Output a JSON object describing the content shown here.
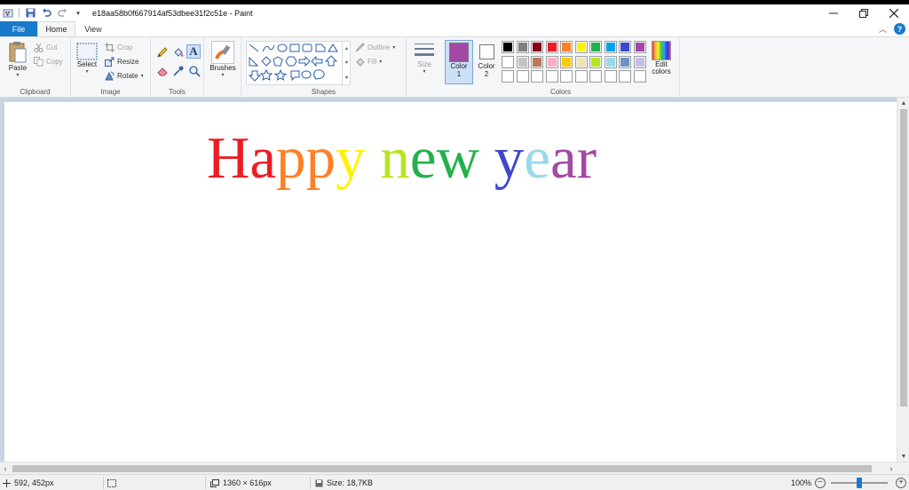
{
  "window": {
    "title": "e18aa58b0f667914af53dbee31f2c51e - Paint",
    "minimize_icon": "minimize-icon",
    "maximize_icon": "restore-icon",
    "close_icon": "close-icon"
  },
  "tabs": {
    "file": "File",
    "home": "Home",
    "view": "View"
  },
  "clipboard": {
    "paste": "Paste",
    "cut": "Cut",
    "copy": "Copy",
    "label": "Clipboard"
  },
  "image": {
    "select": "Select",
    "crop": "Crop",
    "resize": "Resize",
    "rotate": "Rotate",
    "label": "Image"
  },
  "tools": {
    "label": "Tools"
  },
  "brushes": {
    "label": "Brushes"
  },
  "shapes": {
    "outline": "Outline",
    "fill": "Fill",
    "label": "Shapes"
  },
  "size": {
    "label": "Size"
  },
  "colors": {
    "color1_label": "Color",
    "color1_num": "1",
    "color2_label": "Color",
    "color2_num": "2",
    "edit_label_1": "Edit",
    "edit_label_2": "colors",
    "label": "Colors",
    "color1_value": "#a349a4",
    "color2_value": "#ffffff",
    "palette_row1": [
      "#000000",
      "#7f7f7f",
      "#880015",
      "#ed1c24",
      "#ff7f27",
      "#fff200",
      "#22b14c",
      "#00a2e8",
      "#3f48cc",
      "#a349a4"
    ],
    "palette_row2": [
      "#ffffff",
      "#c3c3c3",
      "#b97a57",
      "#ffaec9",
      "#ffc90e",
      "#efe4b0",
      "#b5e61d",
      "#99d9ea",
      "#7092be",
      "#c8bfe7"
    ]
  },
  "canvas": {
    "greeting_letters": [
      {
        "ch": "H",
        "color": "#ed1c24"
      },
      {
        "ch": "a",
        "color": "#ed1c24"
      },
      {
        "ch": "p",
        "color": "#ff7f27"
      },
      {
        "ch": "p",
        "color": "#ff7f27"
      },
      {
        "ch": "y",
        "color": "#fff200"
      },
      {
        "ch": " ",
        "color": "#000000"
      },
      {
        "ch": "n",
        "color": "#b5e61d"
      },
      {
        "ch": "e",
        "color": "#22b14c"
      },
      {
        "ch": "w",
        "color": "#22b14c"
      },
      {
        "ch": " ",
        "color": "#000000"
      },
      {
        "ch": "y",
        "color": "#3f48cc"
      },
      {
        "ch": "e",
        "color": "#99d9ea"
      },
      {
        "ch": "a",
        "color": "#a349a4"
      },
      {
        "ch": "r",
        "color": "#a349a4"
      }
    ]
  },
  "status": {
    "cursor_pos": "592, 452px",
    "dimensions": "1360 × 616px",
    "file_size": "Size: 18,7KB",
    "zoom": "100%",
    "zoom_fraction": 0.5
  }
}
